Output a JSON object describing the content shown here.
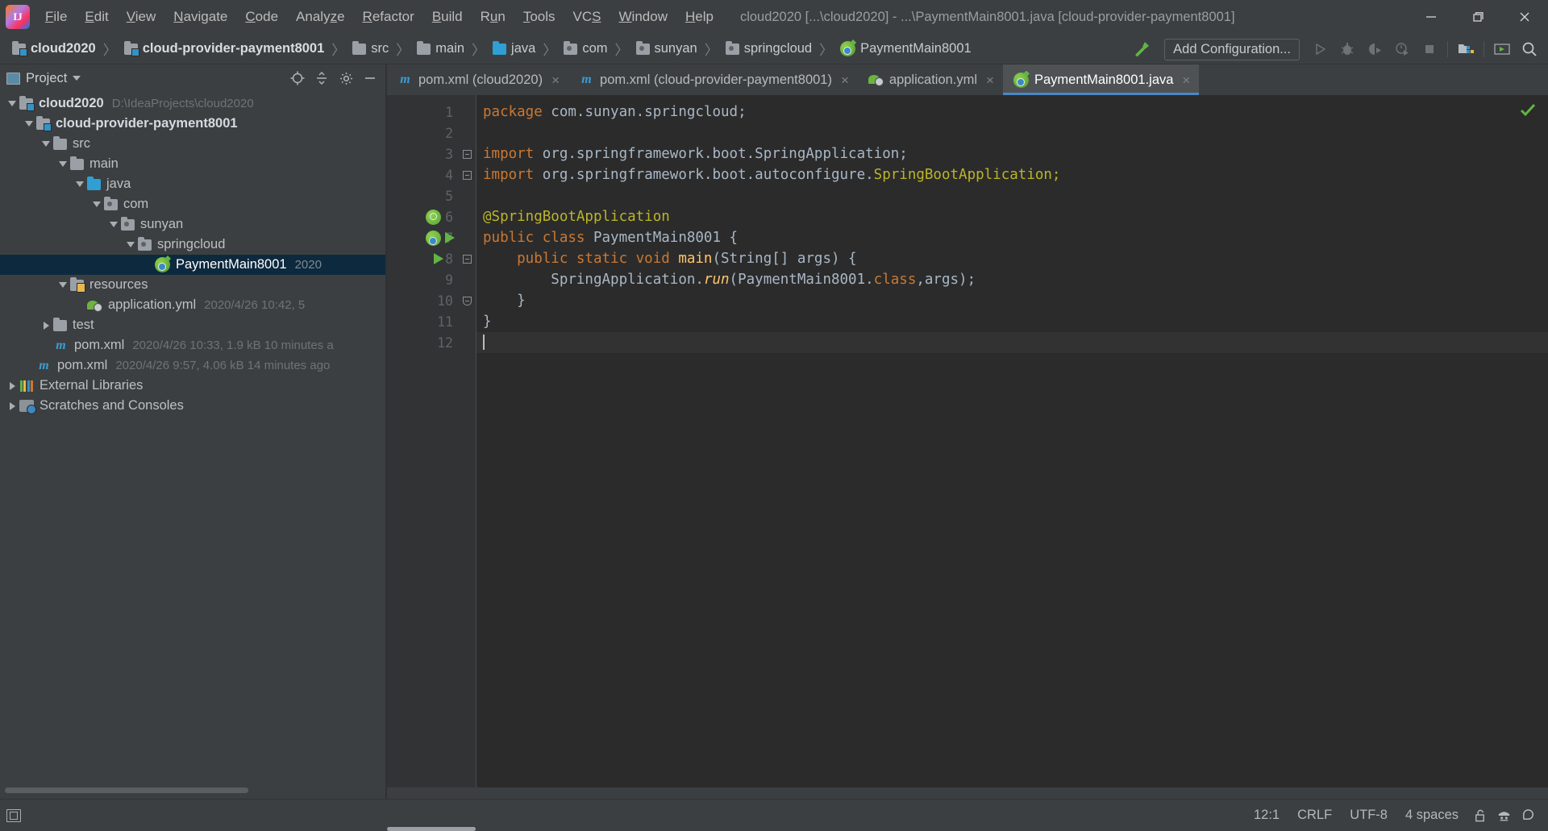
{
  "window": {
    "title": "cloud2020 [...\\cloud2020] - ...\\PaymentMain8001.java [cloud-provider-payment8001]",
    "logo_label": "IJ",
    "controls": {
      "minimize": "minimize-window",
      "maximize": "maximize-window",
      "close": "close-window"
    }
  },
  "menubar": {
    "items": [
      {
        "label": "File",
        "mnemonic": "F"
      },
      {
        "label": "Edit",
        "mnemonic": "E"
      },
      {
        "label": "View",
        "mnemonic": "V"
      },
      {
        "label": "Navigate",
        "mnemonic": "N"
      },
      {
        "label": "Code",
        "mnemonic": "C"
      },
      {
        "label": "Analyze",
        "mnemonic": "z"
      },
      {
        "label": "Refactor",
        "mnemonic": "R"
      },
      {
        "label": "Build",
        "mnemonic": "B"
      },
      {
        "label": "Run",
        "mnemonic": "u"
      },
      {
        "label": "Tools",
        "mnemonic": "T"
      },
      {
        "label": "VCS",
        "mnemonic": "S"
      },
      {
        "label": "Window",
        "mnemonic": "W"
      },
      {
        "label": "Help",
        "mnemonic": "H"
      }
    ]
  },
  "navbar": {
    "crumbs": [
      {
        "label": "cloud2020",
        "icon": "module-folder-icon",
        "bold": true
      },
      {
        "label": "cloud-provider-payment8001",
        "icon": "module-folder-icon",
        "bold": true
      },
      {
        "label": "src",
        "icon": "folder-icon",
        "bold": false
      },
      {
        "label": "main",
        "icon": "folder-icon",
        "bold": false
      },
      {
        "label": "java",
        "icon": "source-folder-icon",
        "bold": false
      },
      {
        "label": "com",
        "icon": "package-icon",
        "bold": false
      },
      {
        "label": "sunyan",
        "icon": "package-icon",
        "bold": false
      },
      {
        "label": "springcloud",
        "icon": "package-icon",
        "bold": false
      },
      {
        "label": "PaymentMain8001",
        "icon": "spring-boot-class-icon",
        "bold": false
      }
    ],
    "separator": "〉",
    "build_button": "build-hammer-icon",
    "add_configuration": "Add Configuration...",
    "buttons": [
      {
        "name": "run-button",
        "glyph": "run"
      },
      {
        "name": "debug-button",
        "glyph": "debug"
      },
      {
        "name": "run-with-coverage-button",
        "glyph": "coverage"
      },
      {
        "name": "profile-button",
        "glyph": "profile"
      },
      {
        "name": "stop-button",
        "glyph": "stop"
      },
      {
        "name": "project-structure-button",
        "glyph": "structure"
      },
      {
        "name": "update-project-button",
        "glyph": "terminal"
      },
      {
        "name": "search-everywhere-button",
        "glyph": "search"
      }
    ]
  },
  "sidebar": {
    "title": "Project",
    "tools": [
      {
        "name": "select-opened-file-button",
        "glyph": "target"
      },
      {
        "name": "collapse-all-button",
        "glyph": "collapse"
      },
      {
        "name": "settings-button",
        "glyph": "gear"
      },
      {
        "name": "hide-button",
        "glyph": "minus"
      }
    ],
    "tree": [
      {
        "indent": 0,
        "arrow": "down",
        "icon": "module-folder-icon",
        "label": "cloud2020",
        "bold": true,
        "sub": "D:\\IdeaProjects\\cloud2020",
        "selected": false
      },
      {
        "indent": 1,
        "arrow": "down",
        "icon": "module-folder-icon",
        "label": "cloud-provider-payment8001",
        "bold": true,
        "sub": "",
        "selected": false
      },
      {
        "indent": 2,
        "arrow": "down",
        "icon": "folder-icon",
        "label": "src",
        "bold": false,
        "sub": "",
        "selected": false
      },
      {
        "indent": 3,
        "arrow": "down",
        "icon": "folder-icon",
        "label": "main",
        "bold": false,
        "sub": "",
        "selected": false
      },
      {
        "indent": 4,
        "arrow": "down",
        "icon": "source-folder-icon",
        "label": "java",
        "bold": false,
        "sub": "",
        "selected": false
      },
      {
        "indent": 5,
        "arrow": "down",
        "icon": "package-icon",
        "label": "com",
        "bold": false,
        "sub": "",
        "selected": false
      },
      {
        "indent": 6,
        "arrow": "down",
        "icon": "package-icon",
        "label": "sunyan",
        "bold": false,
        "sub": "",
        "selected": false
      },
      {
        "indent": 7,
        "arrow": "down",
        "icon": "package-icon",
        "label": "springcloud",
        "bold": false,
        "sub": "",
        "selected": false
      },
      {
        "indent": 8,
        "arrow": "none",
        "icon": "spring-boot-class-icon",
        "label": "PaymentMain8001",
        "bold": false,
        "sub": "2020",
        "selected": true
      },
      {
        "indent": 3,
        "arrow": "down",
        "icon": "resources-folder-icon",
        "label": "resources",
        "bold": false,
        "sub": "",
        "selected": false
      },
      {
        "indent": 4,
        "arrow": "none",
        "icon": "yml-file-icon",
        "label": "application.yml",
        "bold": false,
        "sub": "2020/4/26 10:42, 5",
        "selected": false
      },
      {
        "indent": 2,
        "arrow": "right",
        "icon": "folder-icon",
        "label": "test",
        "bold": false,
        "sub": "",
        "selected": false
      },
      {
        "indent": 2,
        "arrow": "none",
        "icon": "maven-file-icon",
        "label": "pom.xml",
        "bold": false,
        "sub": "2020/4/26 10:33, 1.9 kB 10 minutes a",
        "selected": false
      },
      {
        "indent": 1,
        "arrow": "none",
        "icon": "maven-file-icon",
        "label": "pom.xml",
        "bold": false,
        "sub": "2020/4/26 9:57, 4.06 kB 14 minutes ago",
        "selected": false
      },
      {
        "indent": 0,
        "arrow": "right",
        "icon": "external-libraries-icon",
        "label": "External Libraries",
        "bold": false,
        "sub": "",
        "selected": false
      },
      {
        "indent": 0,
        "arrow": "right",
        "icon": "scratches-icon",
        "label": "Scratches and Consoles",
        "bold": false,
        "sub": "",
        "selected": false
      }
    ]
  },
  "editor": {
    "tabs": [
      {
        "label": "pom.xml (cloud2020)",
        "icon": "maven-file-icon",
        "active": false,
        "close": "×"
      },
      {
        "label": "pom.xml (cloud-provider-payment8001)",
        "icon": "maven-file-icon",
        "active": false,
        "close": "×"
      },
      {
        "label": "application.yml",
        "icon": "yml-file-icon",
        "active": false,
        "close": "×"
      },
      {
        "label": "PaymentMain8001.java",
        "icon": "spring-boot-class-icon",
        "active": true,
        "close": "×"
      }
    ],
    "line_numbers": [
      "1",
      "2",
      "3",
      "4",
      "5",
      "6",
      "7",
      "8",
      "9",
      "10",
      "11",
      "12"
    ],
    "code_lines": [
      {
        "n": 1,
        "tokens": [
          {
            "t": "package ",
            "c": "kw"
          },
          {
            "t": "com.sunyan.springcloud;",
            "c": "pln"
          }
        ]
      },
      {
        "n": 2,
        "tokens": []
      },
      {
        "n": 3,
        "tokens": [
          {
            "t": "import ",
            "c": "kw"
          },
          {
            "t": "org.springframework.boot.SpringApplication;",
            "c": "pln"
          }
        ]
      },
      {
        "n": 4,
        "tokens": [
          {
            "t": "import ",
            "c": "kw"
          },
          {
            "t": "org.springframework.boot.autoconfigure.",
            "c": "pln"
          },
          {
            "t": "SpringBootApplication;",
            "c": "ann"
          }
        ]
      },
      {
        "n": 5,
        "tokens": []
      },
      {
        "n": 6,
        "tokens": [
          {
            "t": "@SpringBootApplication",
            "c": "ann"
          }
        ]
      },
      {
        "n": 7,
        "tokens": [
          {
            "t": "public class ",
            "c": "kw"
          },
          {
            "t": "PaymentMain8001 {",
            "c": "pln"
          }
        ]
      },
      {
        "n": 8,
        "tokens": [
          {
            "t": "    public static void ",
            "c": "kw"
          },
          {
            "t": "main",
            "c": "mth"
          },
          {
            "t": "(String[] args) {",
            "c": "pln"
          }
        ]
      },
      {
        "n": 9,
        "tokens": [
          {
            "t": "        SpringApplication.",
            "c": "pln"
          },
          {
            "t": "run",
            "c": "mthi"
          },
          {
            "t": "(PaymentMain8001.",
            "c": "pln"
          },
          {
            "t": "class",
            "c": "kw"
          },
          {
            "t": ",args);",
            "c": "pln"
          }
        ]
      },
      {
        "n": 10,
        "tokens": [
          {
            "t": "    }",
            "c": "pln"
          }
        ]
      },
      {
        "n": 11,
        "tokens": [
          {
            "t": "}",
            "c": "pln"
          }
        ]
      },
      {
        "n": 12,
        "tokens": []
      }
    ],
    "gutter_icons": [
      {
        "line": 6,
        "name": "spring-bean-gutter-icon"
      },
      {
        "line": 7,
        "name": "spring-boot-run-gutter-icon"
      },
      {
        "line": 7,
        "name": "run-gutter-icon"
      },
      {
        "line": 8,
        "name": "run-gutter-icon"
      }
    ],
    "inspection_status": "no-errors-checkmark"
  },
  "statusbar": {
    "toggle_tool_windows": "toggle-tool-window-bars",
    "items": [
      {
        "name": "caret-position",
        "label": "12:1"
      },
      {
        "name": "line-separator",
        "label": "CRLF"
      },
      {
        "name": "file-encoding",
        "label": "UTF-8"
      },
      {
        "name": "indent-setting",
        "label": "4 spaces"
      }
    ],
    "icons": [
      {
        "name": "lock-icon"
      },
      {
        "name": "hector-inspection-icon"
      },
      {
        "name": "notifications-icon"
      }
    ]
  },
  "colors": {
    "chrome": "#3c3f41",
    "editor_bg": "#2b2b2b",
    "gutter_bg": "#313335",
    "selection": "#0d293e",
    "accent": "#4a88c7",
    "keyword": "#cc7832",
    "annotation": "#bbb529",
    "method": "#ffc66d",
    "text": "#a9b7c6",
    "ok_green": "#62b543"
  }
}
